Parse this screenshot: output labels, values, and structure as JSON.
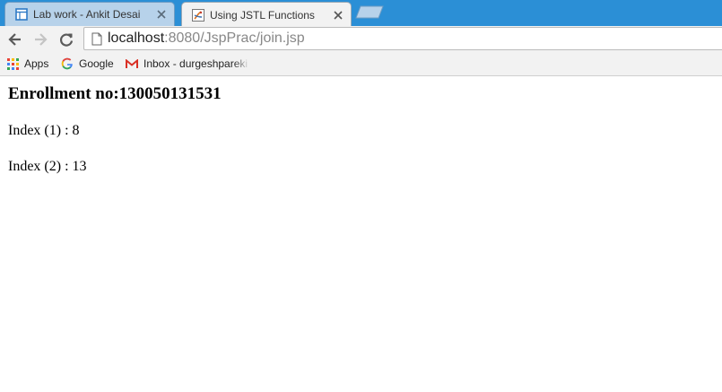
{
  "tabs": [
    {
      "title": "Lab work - Ankit Desai",
      "active": false,
      "icon": "docs-icon"
    },
    {
      "title": "Using JSTL Functions",
      "active": true,
      "icon": "java-icon"
    }
  ],
  "address_bar": {
    "host": "localhost",
    "rest": ":8080/JspPrac/join.jsp"
  },
  "bookmarks": [
    {
      "label": "Apps",
      "icon": "apps-grid-icon"
    },
    {
      "label": "Google",
      "icon": "google-icon"
    },
    {
      "label": "Inbox - durgeshpareki",
      "icon": "gmail-icon"
    }
  ],
  "page": {
    "heading": "Enrollment no:130050131531",
    "lines": [
      "Index (1) : 8",
      "Index (2) : 13"
    ]
  },
  "colors": {
    "tabstrip": "#2b8fd6",
    "toolbar": "#f2f2f2",
    "inactive_tab": "#b7d2ea"
  }
}
